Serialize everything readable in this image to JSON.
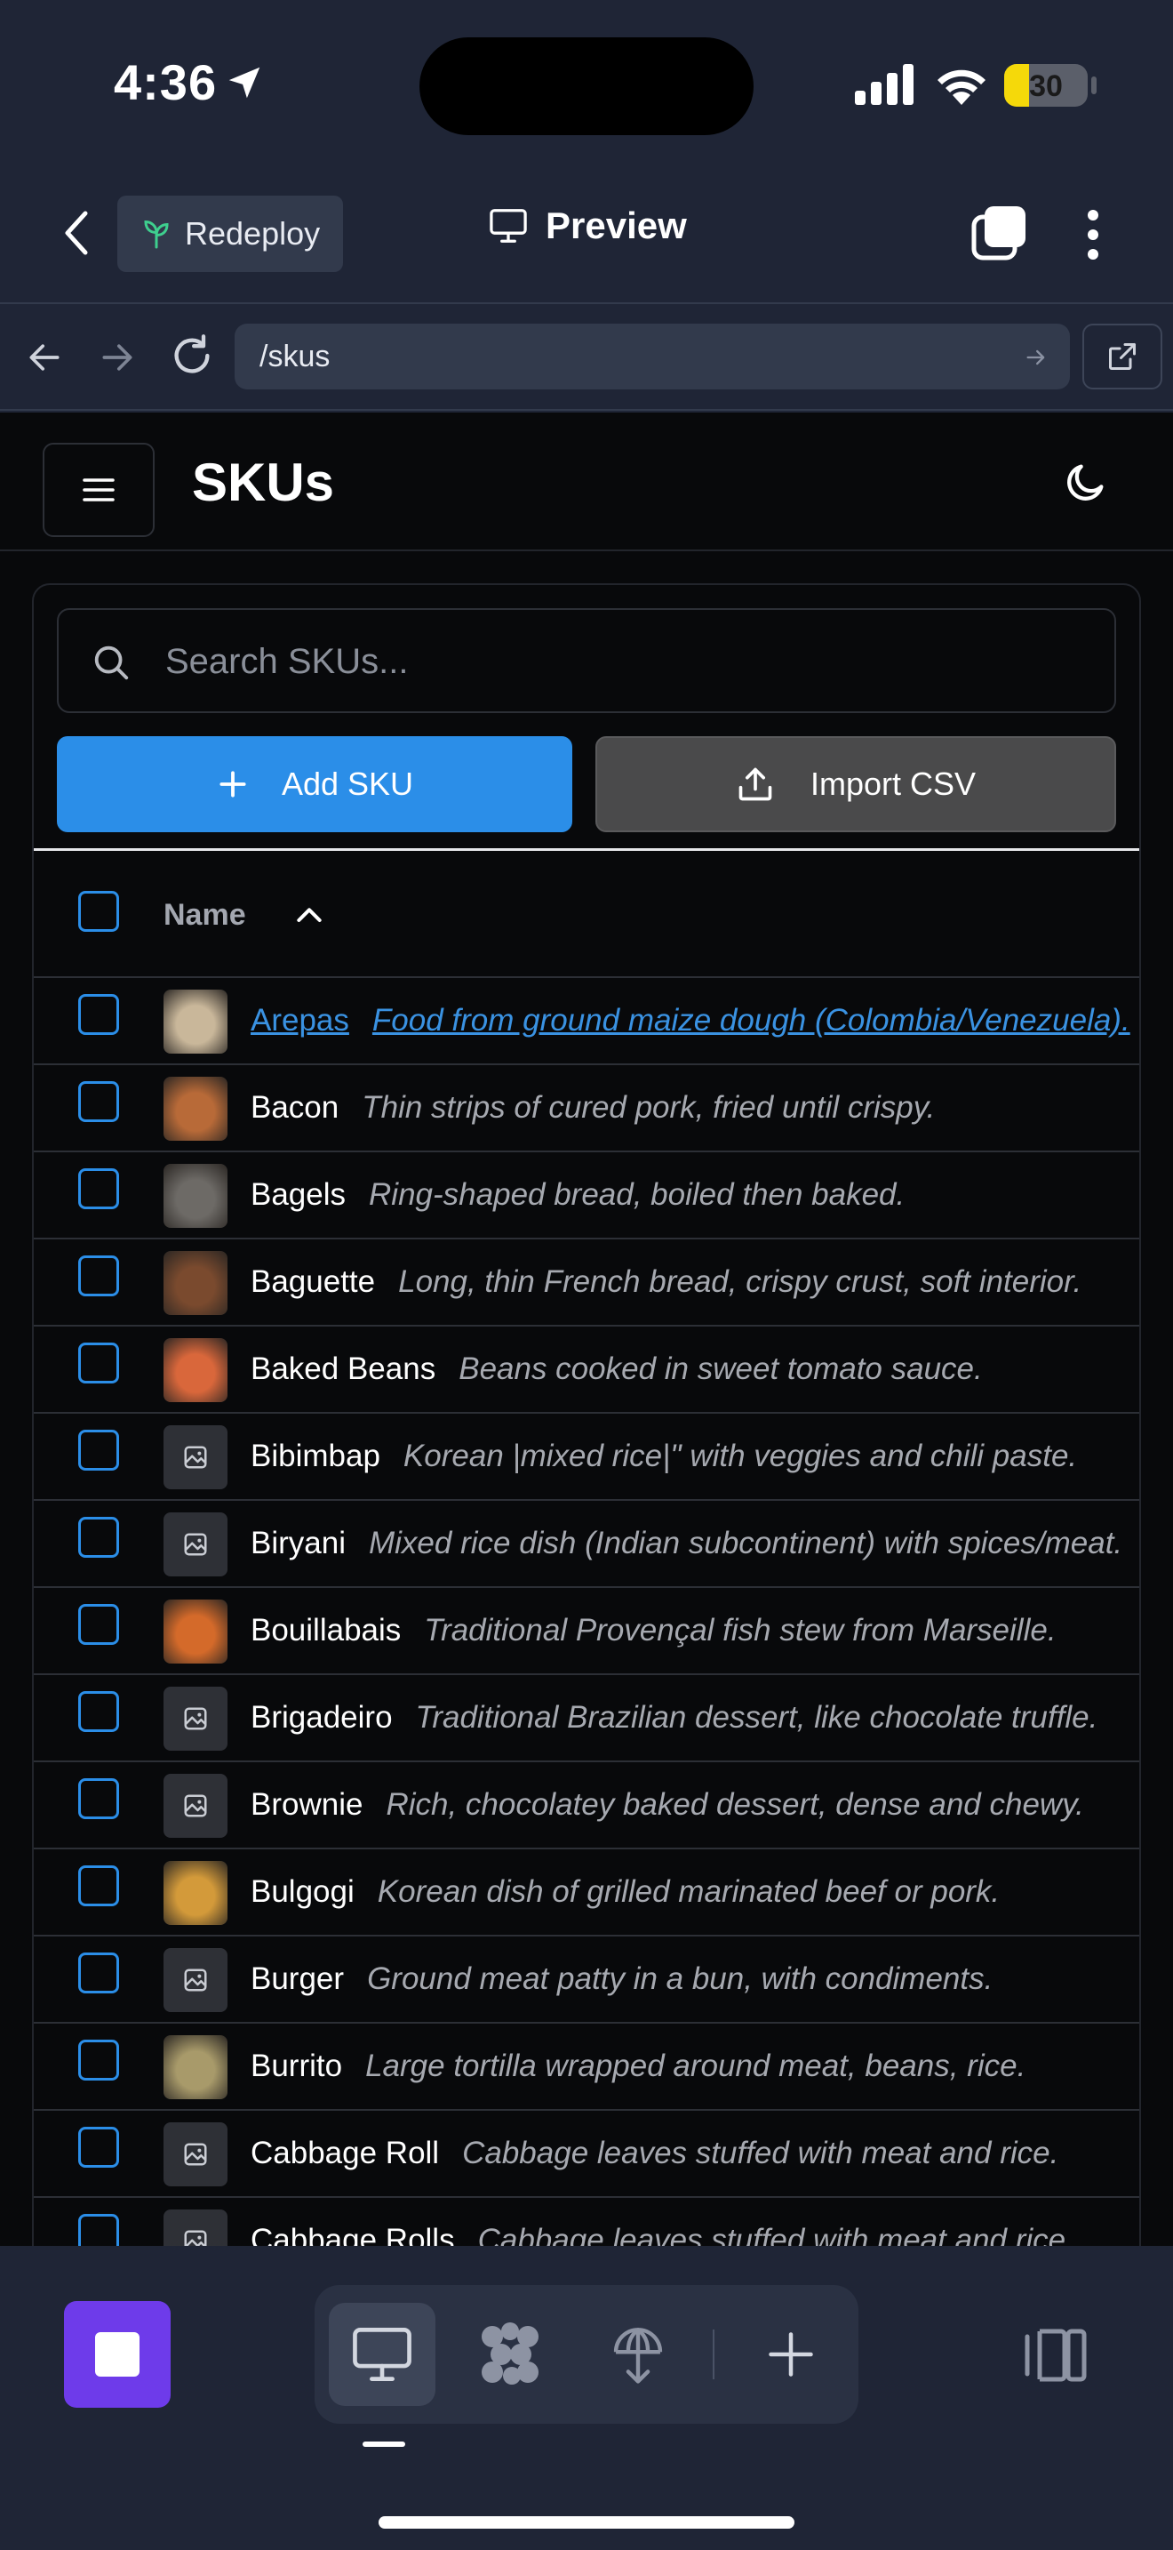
{
  "status_bar": {
    "time": "4:36",
    "battery": "30",
    "battery_level": 0.3
  },
  "header": {
    "redeploy_label": "Redeploy",
    "preview_label": "Preview"
  },
  "browser": {
    "url": "/skus"
  },
  "page": {
    "title": "SKUs",
    "search_placeholder": "Search SKUs...",
    "add_label": "Add SKU",
    "import_label": "Import CSV",
    "column_name": "Name"
  },
  "rows": [
    {
      "name": "Arepas",
      "desc": "Food from ground maize dough (Colombia/Venezuela).",
      "image": "photo",
      "color": "#c9b79a",
      "link": true
    },
    {
      "name": "Bacon",
      "desc": "Thin strips of cured pork, fried until crispy.",
      "image": "photo",
      "color": "#b86a38"
    },
    {
      "name": "Bagels",
      "desc": "Ring-shaped bread, boiled then baked.",
      "image": "photo",
      "color": "#6d6a66"
    },
    {
      "name": "Baguette",
      "desc": "Long, thin French bread, crispy crust, soft interior.",
      "image": "photo",
      "color": "#7a4a2e"
    },
    {
      "name": "Baked Beans",
      "desc": "Beans cooked in sweet tomato sauce.",
      "image": "photo",
      "color": "#d9673b"
    },
    {
      "name": "Bibimbap",
      "desc": "Korean |mixed rice|\" with veggies and chili paste.",
      "image": "placeholder"
    },
    {
      "name": "Biryani",
      "desc": "Mixed rice dish (Indian subcontinent) with spices/meat.",
      "image": "placeholder"
    },
    {
      "name": "Bouillabais",
      "desc": "Traditional Provençal fish stew from Marseille.",
      "image": "photo",
      "color": "#d46a2a"
    },
    {
      "name": "Brigadeiro",
      "desc": "Traditional Brazilian dessert, like chocolate truffle.",
      "image": "placeholder"
    },
    {
      "name": "Brownie",
      "desc": "Rich, chocolatey baked dessert, dense and chewy.",
      "image": "placeholder"
    },
    {
      "name": "Bulgogi",
      "desc": "Korean dish of grilled marinated beef or pork.",
      "image": "photo",
      "color": "#d39a3a"
    },
    {
      "name": "Burger",
      "desc": "Ground meat patty in a bun, with condiments.",
      "image": "placeholder"
    },
    {
      "name": "Burrito",
      "desc": "Large tortilla wrapped around meat, beans, rice.",
      "image": "photo",
      "color": "#a89a6a"
    },
    {
      "name": "Cabbage Roll",
      "desc": "Cabbage leaves stuffed with meat and rice.",
      "image": "placeholder"
    },
    {
      "name": "Cabbage Rolls",
      "desc": "Cabbage leaves stuffed with meat and rice.",
      "image": "placeholder"
    }
  ],
  "colors": {
    "accent": "#2b8ee8",
    "stop_button": "#6e3bea",
    "background": "#08090b"
  }
}
